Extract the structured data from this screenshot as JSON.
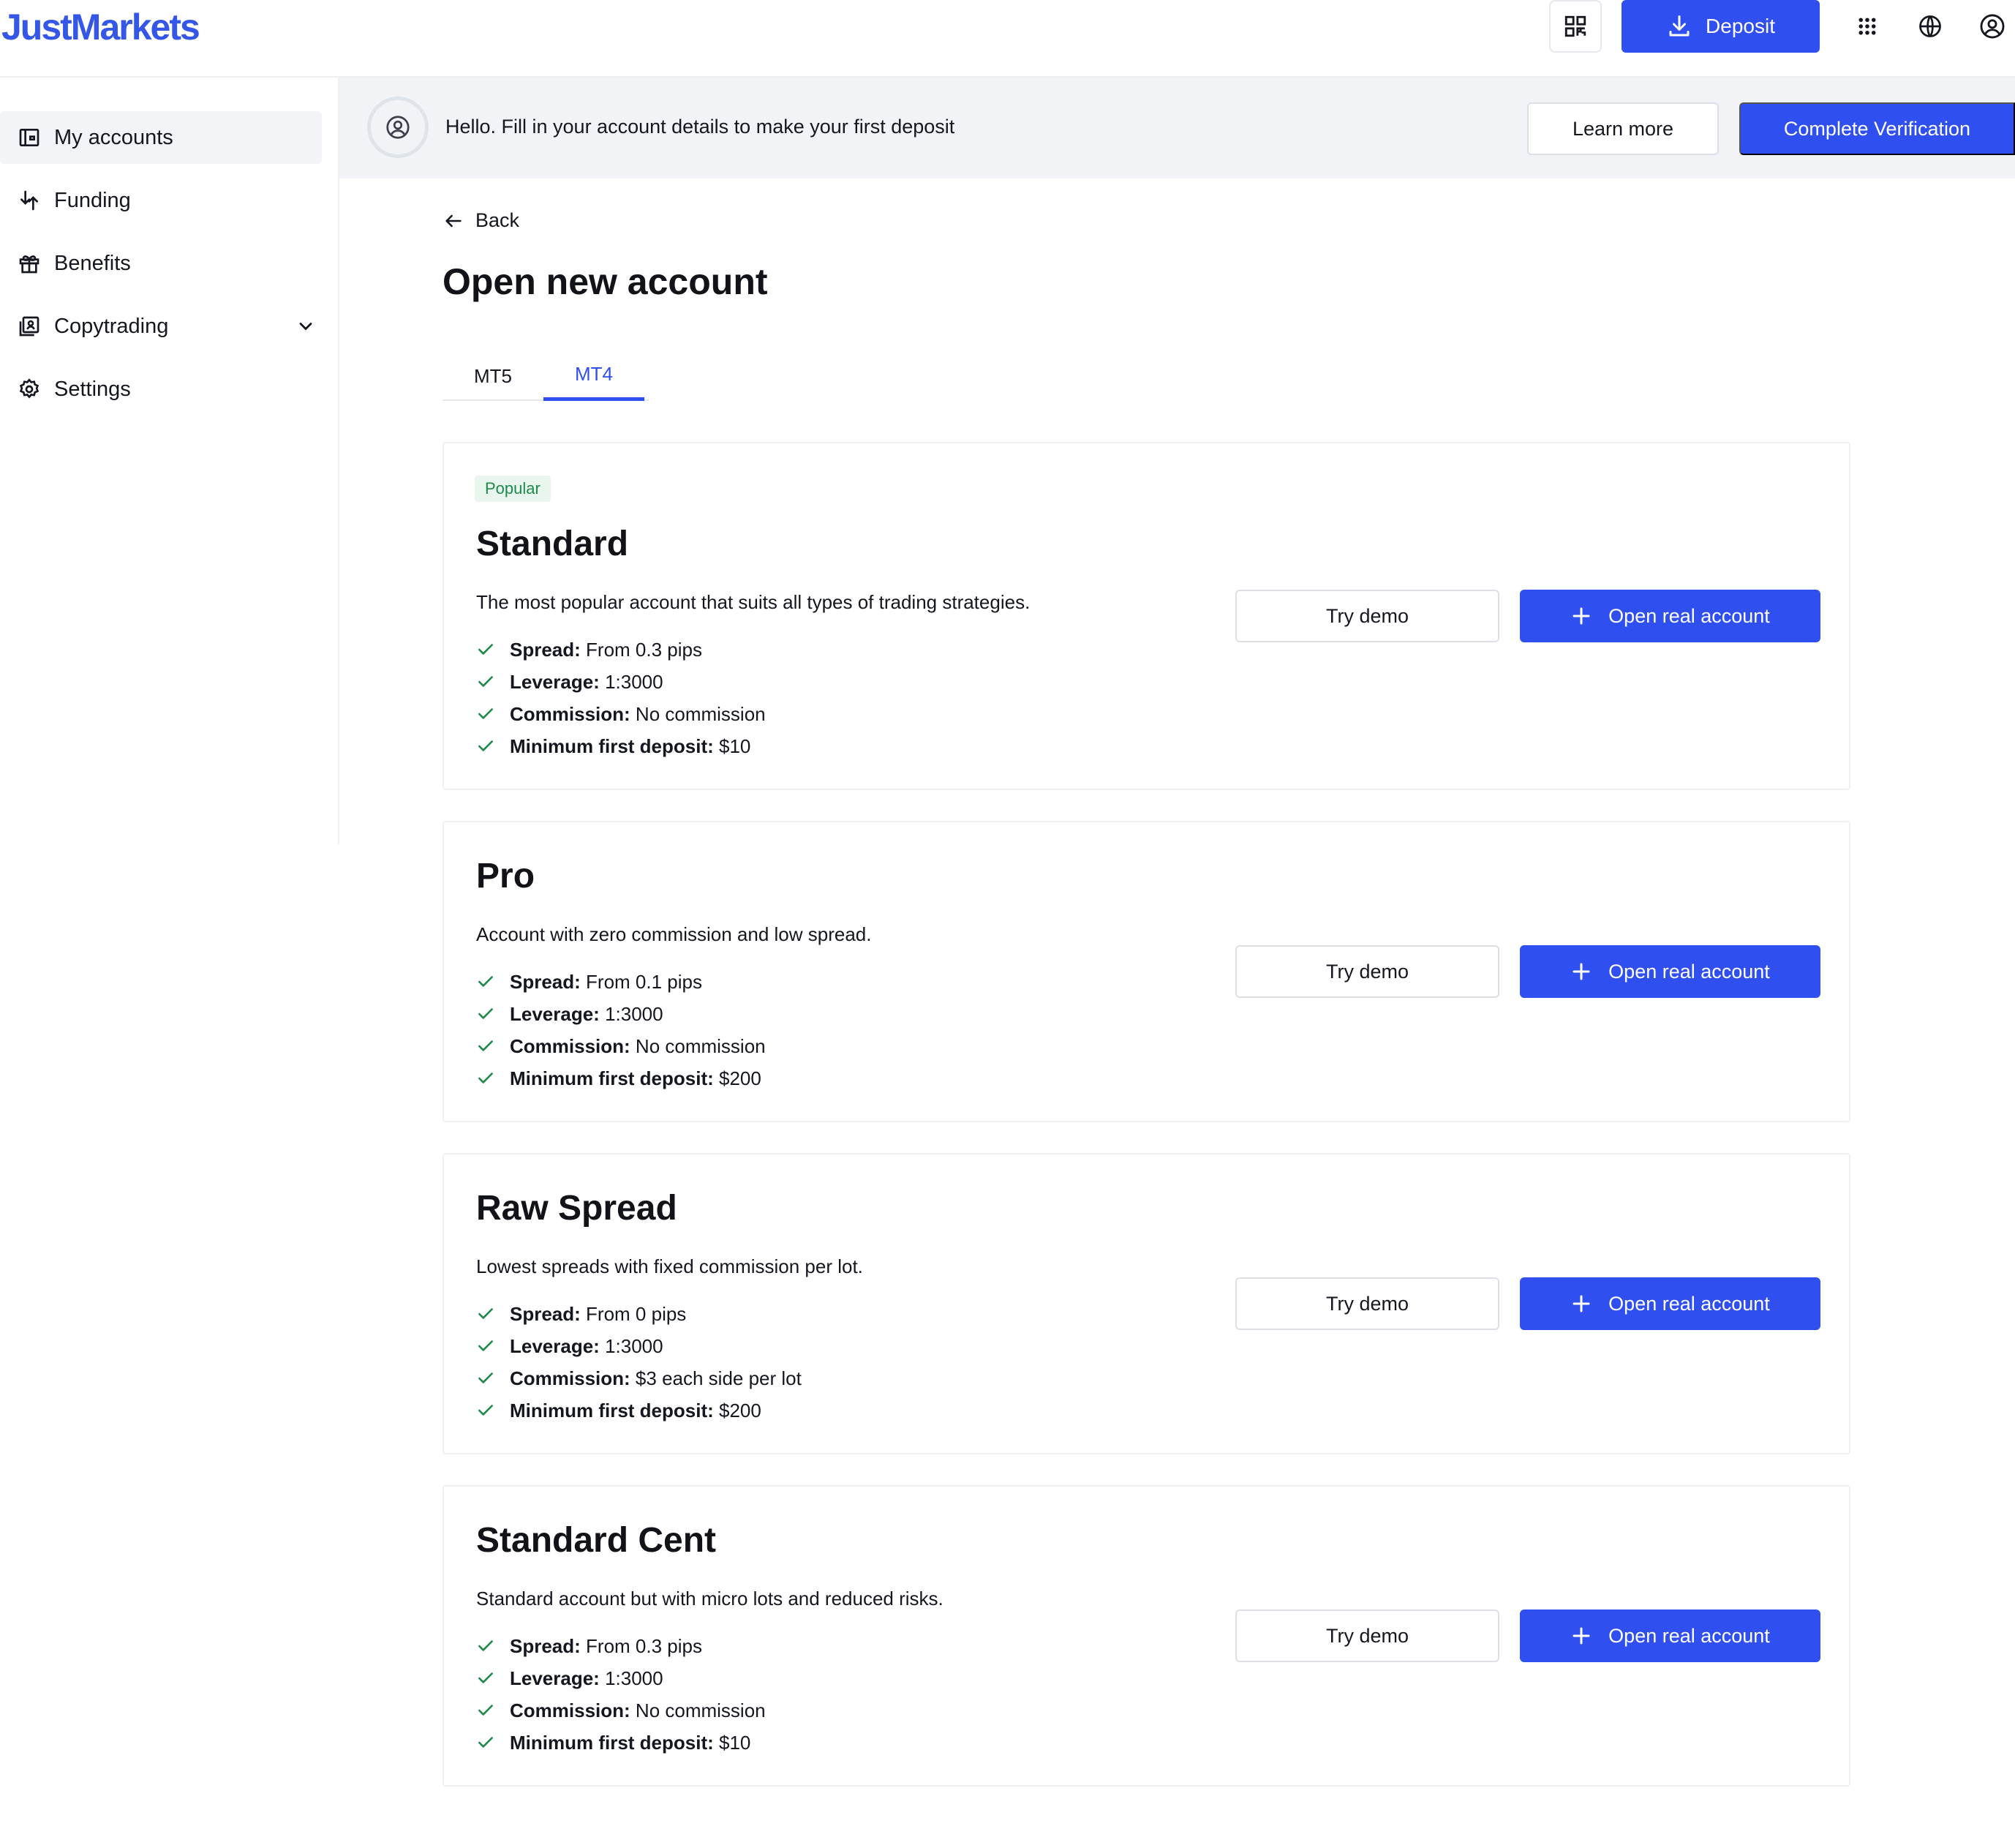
{
  "app": {
    "logo": "JustMarkets"
  },
  "header": {
    "deposit_label": "Deposit"
  },
  "sidebar": {
    "items": [
      {
        "label": "My accounts",
        "icon": "wallet-icon"
      },
      {
        "label": "Funding",
        "icon": "funding-icon"
      },
      {
        "label": "Benefits",
        "icon": "gift-icon"
      },
      {
        "label": "Copytrading",
        "icon": "copytrading-icon"
      },
      {
        "label": "Settings",
        "icon": "gear-icon"
      }
    ]
  },
  "banner": {
    "text": "Hello. Fill in your account details to make your first deposit",
    "learn_more": "Learn more",
    "complete_verification": "Complete Verification"
  },
  "main": {
    "back_label": "Back",
    "title": "Open new account",
    "tabs": [
      {
        "label": "MT5",
        "active": false
      },
      {
        "label": "MT4",
        "active": true
      }
    ],
    "try_demo_label": "Try demo",
    "open_real_label": "Open real account",
    "accounts": [
      {
        "badge": "Popular",
        "name": "Standard",
        "description": "The most popular account that suits all types of trading strategies.",
        "features": [
          {
            "label": "Spread:",
            "value": "From 0.3 pips"
          },
          {
            "label": "Leverage:",
            "value": "1:3000"
          },
          {
            "label": "Commission:",
            "value": "No commission"
          },
          {
            "label": "Minimum first deposit:",
            "value": "$10"
          }
        ]
      },
      {
        "name": "Pro",
        "description": "Account with zero commission and low spread.",
        "features": [
          {
            "label": "Spread:",
            "value": "From 0.1 pips"
          },
          {
            "label": "Leverage:",
            "value": "1:3000"
          },
          {
            "label": "Commission:",
            "value": "No commission"
          },
          {
            "label": "Minimum first deposit:",
            "value": "$200"
          }
        ]
      },
      {
        "name": "Raw Spread",
        "description": "Lowest spreads with fixed commission per lot.",
        "features": [
          {
            "label": "Spread:",
            "value": "From 0 pips"
          },
          {
            "label": "Leverage:",
            "value": "1:3000"
          },
          {
            "label": "Commission:",
            "value": "$3 each side per lot"
          },
          {
            "label": "Minimum first deposit:",
            "value": "$200"
          }
        ]
      },
      {
        "name": "Standard Cent",
        "description": "Standard account but with micro lots and reduced risks.",
        "features": [
          {
            "label": "Spread:",
            "value": "From 0.3 pips"
          },
          {
            "label": "Leverage:",
            "value": "1:3000"
          },
          {
            "label": "Commission:",
            "value": "No commission"
          },
          {
            "label": "Minimum first deposit:",
            "value": "$10"
          }
        ]
      }
    ]
  },
  "colors": {
    "brand": "#2f4ff0",
    "logo": "#3457e8",
    "check": "#1d8a4a",
    "badge_bg": "#e8f6ee"
  }
}
